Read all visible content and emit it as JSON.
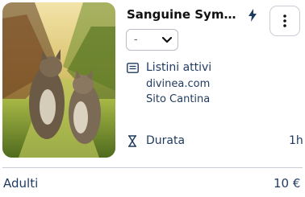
{
  "product": {
    "image_label": "cats-in-vineyard-photo",
    "title": "Sanguine Symph…",
    "select_value": "-",
    "listini": {
      "title": "Listini attivi",
      "items": [
        "divinea.com",
        "Sito Cantina"
      ]
    },
    "durata": {
      "label": "Durata",
      "value": "1h"
    }
  },
  "pricing": {
    "label": "Adulti",
    "price": "10 €"
  },
  "colors": {
    "text": "#1f3a5f",
    "border": "#c8cdd4",
    "bolt": "#1f3a5f"
  },
  "icons": [
    "bolt-icon",
    "kebab-menu-icon",
    "chevron-down-icon",
    "list-icon",
    "hourglass-icon"
  ]
}
